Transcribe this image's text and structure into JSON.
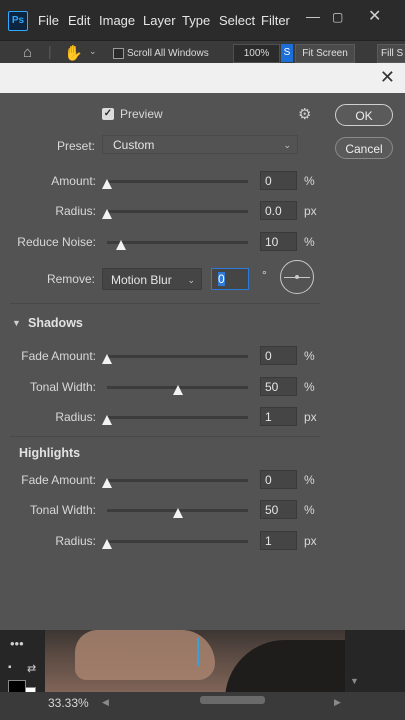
{
  "app": {
    "logo_text": "Ps"
  },
  "menubar": {
    "items": [
      "File",
      "Edit",
      "Image",
      "Layer",
      "Type",
      "Select",
      "Filter"
    ]
  },
  "options_bar": {
    "scroll_all_windows": "Scroll All Windows",
    "zoom": "100%",
    "blue_btn": "S",
    "fit_screen": "Fit Screen",
    "fill_screen": "Fill S"
  },
  "dialog": {
    "preview_label": "Preview",
    "preview_checked": true,
    "preset_label": "Preset:",
    "preset_value": "Custom",
    "ok_label": "OK",
    "cancel_label": "Cancel",
    "remove_label": "Remove:",
    "remove_value": "Motion Blur",
    "angle_value": "0",
    "angle_unit": "°",
    "rows": [
      {
        "label": "Amount:",
        "value": "0",
        "unit": "%",
        "fraction": 0.0
      },
      {
        "label": "Radius:",
        "value": "0.0",
        "unit": "px",
        "fraction": 0.0
      },
      {
        "label": "Reduce Noise:",
        "value": "10",
        "unit": "%",
        "fraction": 0.1
      }
    ],
    "shadows": {
      "title": "Shadows",
      "rows": [
        {
          "label": "Fade Amount:",
          "value": "0",
          "unit": "%",
          "fraction": 0.0
        },
        {
          "label": "Tonal Width:",
          "value": "50",
          "unit": "%",
          "fraction": 0.5
        },
        {
          "label": "Radius:",
          "value": "1",
          "unit": "px",
          "fraction": 0.0
        }
      ]
    },
    "highlights": {
      "title": "Highlights",
      "rows": [
        {
          "label": "Fade Amount:",
          "value": "0",
          "unit": "%",
          "fraction": 0.0
        },
        {
          "label": "Tonal Width:",
          "value": "50",
          "unit": "%",
          "fraction": 0.5
        },
        {
          "label": "Radius:",
          "value": "1",
          "unit": "px",
          "fraction": 0.0
        }
      ]
    }
  },
  "status": {
    "zoom": "33.33%"
  }
}
